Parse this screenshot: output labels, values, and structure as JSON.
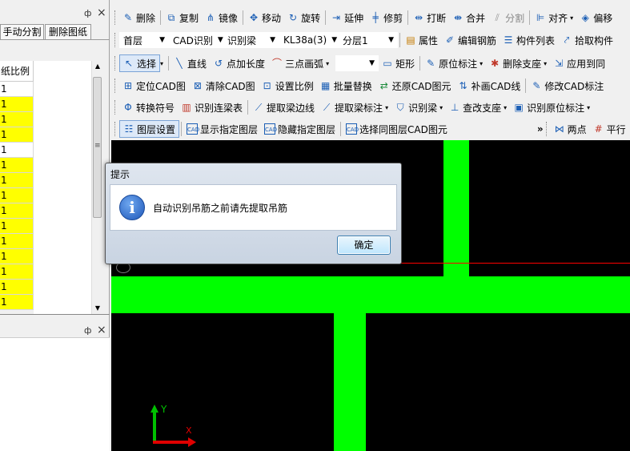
{
  "left_panel": {
    "tabs": [
      "手动分割",
      "删除图纸"
    ],
    "column_header": "纸比例",
    "rows": [
      {
        "value": "1",
        "highlight": false
      },
      {
        "value": "1",
        "highlight": true
      },
      {
        "value": "1",
        "highlight": true
      },
      {
        "value": "1",
        "highlight": true
      },
      {
        "value": "1",
        "highlight": false
      },
      {
        "value": "1",
        "highlight": true
      },
      {
        "value": "1",
        "highlight": true
      },
      {
        "value": "1",
        "highlight": true
      },
      {
        "value": "1",
        "highlight": true
      },
      {
        "value": "1",
        "highlight": true
      },
      {
        "value": "1",
        "highlight": true
      },
      {
        "value": "1",
        "highlight": true
      },
      {
        "value": "1",
        "highlight": true
      },
      {
        "value": "1",
        "highlight": true
      },
      {
        "value": "1",
        "highlight": true
      }
    ],
    "pin_symbol": "ф",
    "close_symbol": "×",
    "scroll_mark": "≡"
  },
  "toolbar1": {
    "delete": "删除",
    "copy": "复制",
    "mirror": "镜像",
    "move": "移动",
    "rotate": "旋转",
    "extend": "延伸",
    "trim": "修剪",
    "break": "打断",
    "merge": "合并",
    "split": "分割",
    "align": "对齐",
    "offset": "偏移"
  },
  "toolbar2": {
    "floor": "首层",
    "cad_identify": "CAD识别",
    "identify_beam": "识别梁",
    "beam_id": "KL38a(3)",
    "layer": "分层1",
    "attributes": "属性",
    "edit_rebar": "编辑钢筋",
    "component_list": "构件列表",
    "pick_component": "拾取构件"
  },
  "toolbar3": {
    "select": "选择",
    "line": "直线",
    "point_length": "点加长度",
    "three_point_arc": "三点画弧",
    "rect": "矩形",
    "original_annotation": "原位标注",
    "delete_support": "删除支座",
    "apply_to_same": "应用到同"
  },
  "toolbar4": {
    "locate_cad": "定位CAD图",
    "clear_cad": "清除CAD图",
    "set_scale": "设置比例",
    "batch_replace": "批量替换",
    "restore_cad": "还原CAD图元",
    "redraw_cad_line": "补画CAD线",
    "modify_cad_annotation": "修改CAD标注"
  },
  "toolbar5": {
    "convert_symbol": "转换符号",
    "identify_continuous_beam": "识别连梁表",
    "extract_beam_edge": "提取梁边线",
    "extract_beam_annotation": "提取梁标注",
    "identify_beam": "识别梁",
    "check_support": "查改支座",
    "identify_original_annotation": "识别原位标注"
  },
  "toolbar6": {
    "layer_settings": "图层设置",
    "show_layer": "显示指定图层",
    "hide_layer": "隐藏指定图层",
    "select_same_layer": "选择同图层CAD图元",
    "two_points": "两点",
    "parallel": "平行",
    "more": "»"
  },
  "dialog": {
    "title": "提示",
    "message": "自动识别吊筋之前请先提取吊筋",
    "ok_button": "确定",
    "info_icon": "i"
  },
  "canvas": {
    "background": "#000000",
    "beam_color": "#00ff00",
    "axis_y_label": "Y",
    "axis_x_label": "X"
  }
}
